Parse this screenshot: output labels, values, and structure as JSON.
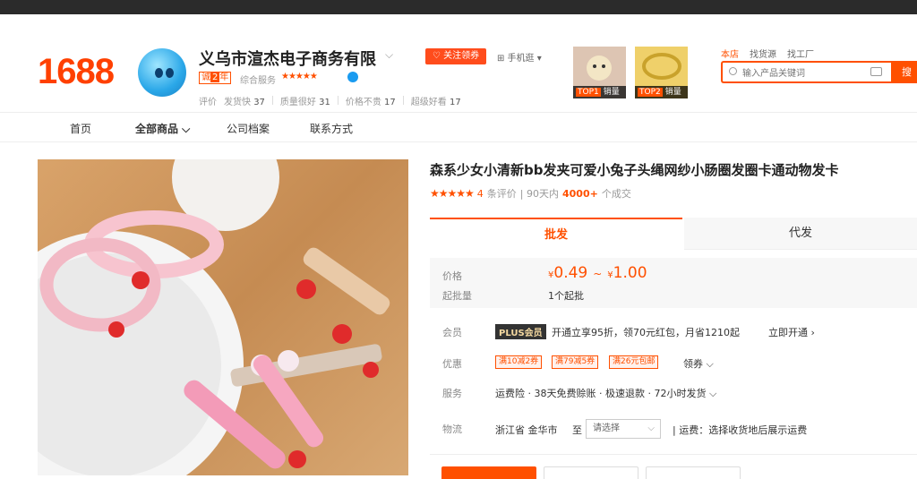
{
  "header": {
    "logo": "1688",
    "shop_name": "义乌市渲杰电子商务有限",
    "shop_chevron": "⌵",
    "year_badge_num": "2",
    "year_badge_unit": "年",
    "year_badge_prefix": "诚",
    "service_label": "综合服务",
    "stars": "★★★★★",
    "eval_label": "评价",
    "evals": [
      {
        "label": "发货快",
        "value": "37"
      },
      {
        "label": "质量很好",
        "value": "31"
      },
      {
        "label": "价格不贵",
        "value": "17"
      },
      {
        "label": "超级好看",
        "value": "17"
      }
    ],
    "follow_btn": "♡ 关注领券",
    "phone_link": "⊞ 手机逛 ▾",
    "hot_items": [
      {
        "rank": "TOP1",
        "label": "销量"
      },
      {
        "rank": "TOP2",
        "label": "销量"
      }
    ],
    "search_tabs": [
      "本店",
      "找货源",
      "找工厂"
    ],
    "search_placeholder": "输入产品关键词",
    "search_button": "搜"
  },
  "nav": [
    "首页",
    "全部商品 ⌵",
    "公司档案",
    "联系方式"
  ],
  "product": {
    "title": "森系少女小清新bb发夹可爱小兔子头绳网纱小肠圈发圈卡通动物发卡",
    "stars": "★★★★★",
    "review_count": "4",
    "review_label": "条评价",
    "sold_prefix": "| 90天内",
    "sold_count": "4000+",
    "sold_suffix": "个成交",
    "tab_wholesale": "批发",
    "tab_dropship": "代发",
    "price_label": "价格",
    "price_currency": "¥",
    "price_low": "0.49",
    "price_tilde": "~",
    "price_high": "1.00",
    "moq_label": "起批量",
    "moq_value": "1个起批",
    "member_label": "会员",
    "plus_tag": "PLUS会员",
    "plus_text": "开通立享95折，领70元红包，月省1210起",
    "plus_open": "立即开通 ›",
    "discount_label": "优惠",
    "coupons": [
      "满10减2券",
      "满79减5券",
      "满26元包邮"
    ],
    "get_coupon": "领券 ⌵",
    "service_label": "服务",
    "service_text": "运费险 · 38天免费赊账 · 极速退款 · 72小时发货 ⌵",
    "logistics_label": "物流",
    "logistics_from": "浙江省 金华市",
    "logistics_to": "至",
    "select_placeholder": "请选择",
    "freight_text": "| 运费：选择收货地后展示运费"
  },
  "colors": {
    "accent": "#ff5000",
    "logo": "#ff4000"
  }
}
